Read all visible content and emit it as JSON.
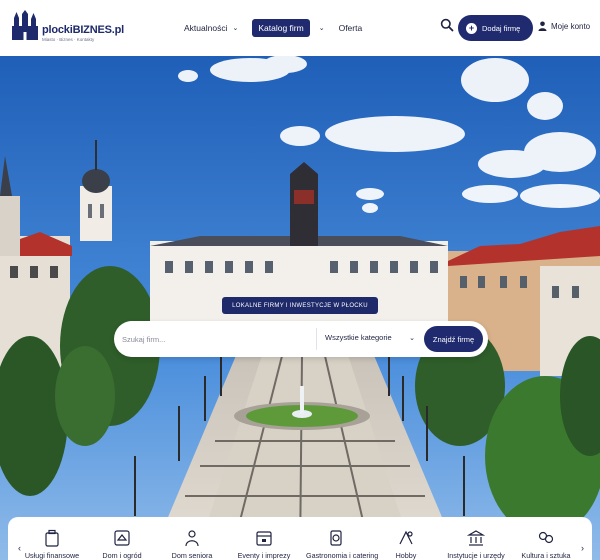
{
  "brand": {
    "name": "plockiBIZNES.pl",
    "tagline": "Miasto · Biznes · Kontakty"
  },
  "nav": {
    "aktualnosci": "Aktualności",
    "katalog": "Katalog firm",
    "oferta": "Oferta"
  },
  "header": {
    "add_label": "Dodaj firmę",
    "account_label": "Moje konto"
  },
  "hero": {
    "badge": "LOKALNE FIRMY I INWESTYCJE W PŁOCKU",
    "headline": "Miasto. Biznes. Kontakty."
  },
  "search": {
    "placeholder": "Szukaj firm...",
    "category_selected": "Wszystkie kategorie",
    "button_label": "Znajdź firmę"
  },
  "categories": [
    {
      "label": "Usługi finansowe",
      "icon": "briefcase-icon"
    },
    {
      "label": "Dom i ogród",
      "icon": "home-tools-icon"
    },
    {
      "label": "Dom seniora",
      "icon": "senior-care-icon"
    },
    {
      "label": "Eventy i imprezy",
      "icon": "calendar-icon"
    },
    {
      "label": "Gastronomia i catering",
      "icon": "dining-icon"
    },
    {
      "label": "Hobby",
      "icon": "hobby-icon"
    },
    {
      "label": "Instytucje i urzędy",
      "icon": "institution-icon"
    },
    {
      "label": "Kultura i sztuka",
      "icon": "culture-icon"
    }
  ],
  "colors": {
    "brand_navy": "#202a6e",
    "white": "#ffffff"
  }
}
